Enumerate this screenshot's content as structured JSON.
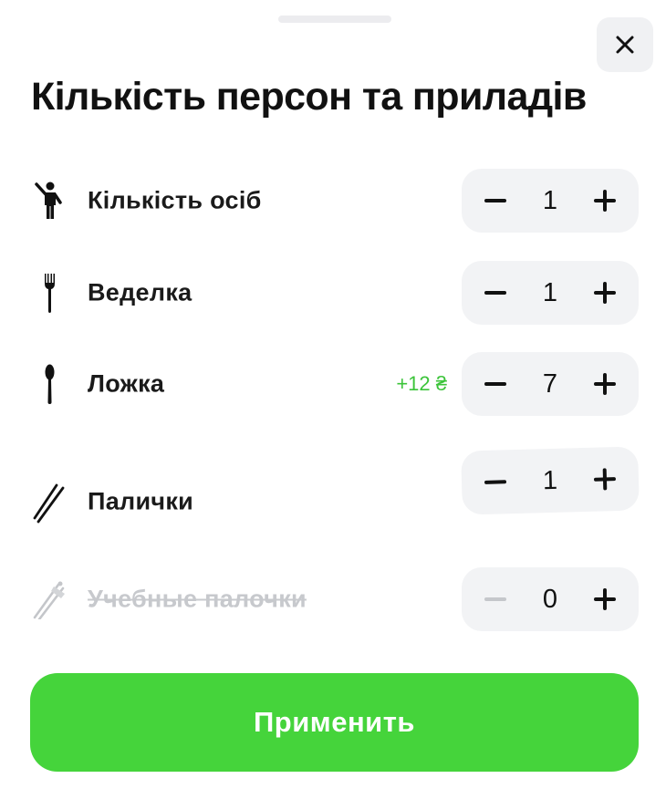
{
  "sheet": {
    "title": "Кількість персон та приладів",
    "close_icon": "close-icon"
  },
  "rows": [
    {
      "id": "persons",
      "icon": "person-icon",
      "label": "Кількість осіб",
      "extra": "",
      "value": "1",
      "minus_enabled": true
    },
    {
      "id": "fork",
      "icon": "fork-icon",
      "label": "Веделка",
      "extra": "",
      "value": "1",
      "minus_enabled": true
    },
    {
      "id": "spoon",
      "icon": "spoon-icon",
      "label": "Ложка",
      "extra": "+12 ₴",
      "value": "7",
      "minus_enabled": true
    },
    {
      "id": "chopsticks",
      "icon": "chopsticks-icon",
      "label": "Палички",
      "extra": "",
      "value": "1",
      "minus_enabled": true
    },
    {
      "id": "training-chopsticks",
      "icon": "training-chopsticks-icon",
      "label": "Учебные палочки",
      "extra": "",
      "value": "0",
      "minus_enabled": false,
      "disabled_label": true
    }
  ],
  "apply_button": {
    "label": "Применить"
  },
  "colors": {
    "accent_green": "#45d43b",
    "price_green": "#3cc43a",
    "stepper_bg": "#f2f3f5",
    "disabled_text": "#c7c9cd"
  }
}
